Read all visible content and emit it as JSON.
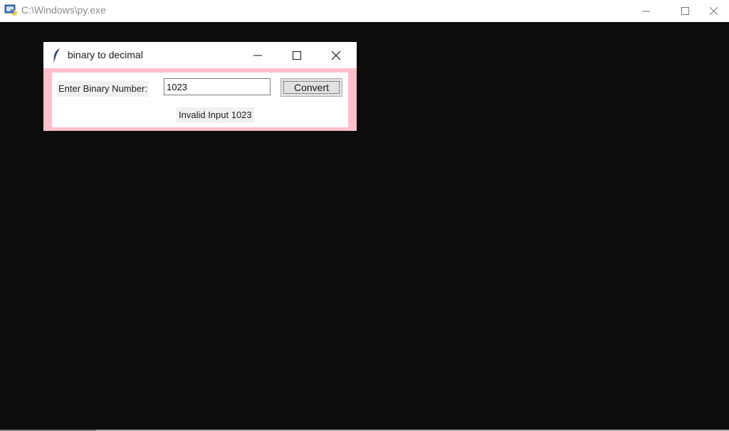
{
  "console": {
    "title": "C:\\Windows\\py.exe",
    "icons": {
      "app": "python-console-icon",
      "minimize": "minimize-icon",
      "maximize": "maximize-icon",
      "close": "close-icon"
    }
  },
  "app_window": {
    "title": "binary to decimal",
    "icons": {
      "app": "tk-feather-icon",
      "minimize": "minimize-icon",
      "maximize": "maximize-icon",
      "close": "close-icon"
    },
    "colors": {
      "border": "#ffc0cb",
      "content_bg": "#ffffff",
      "widget_bg": "#f0f0f0"
    },
    "form": {
      "label": "Enter Binary Number:",
      "entry_value": "1023",
      "convert_button": "Convert",
      "result_text": "Invalid Input 1023"
    }
  }
}
